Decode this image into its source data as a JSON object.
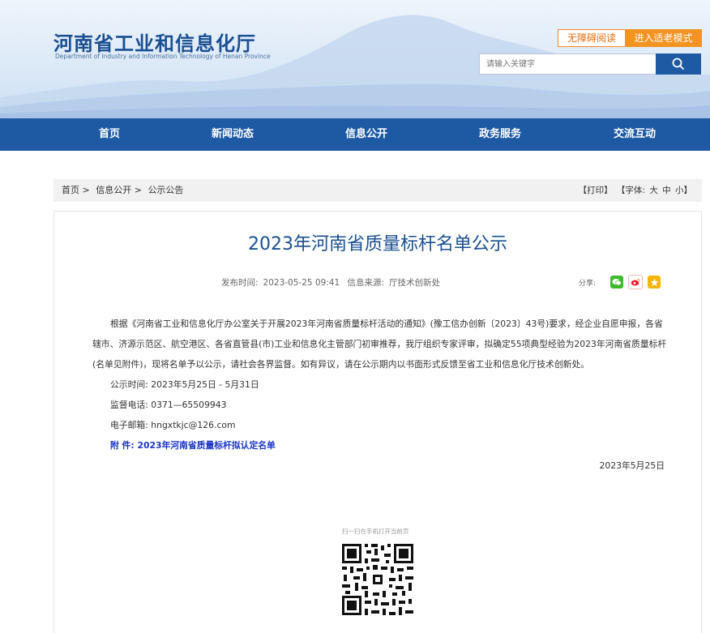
{
  "header": {
    "site_title": "河南省工业和信息化厅",
    "site_subtitle": "Department of Industry and Information Technology of Henan Province",
    "accessibility_label": "无障碍阅读",
    "elder_mode_label": "进入适老模式",
    "search_placeholder": "请输入关键字",
    "brand_color": "#1d5aa3",
    "accent_color": "#f39321"
  },
  "nav": {
    "items": [
      "首页",
      "新闻动态",
      "信息公开",
      "政务服务",
      "交流互动"
    ]
  },
  "breadcrumb": {
    "items": [
      "首页 >",
      "信息公开 >",
      "公示公告"
    ]
  },
  "tools": {
    "print": "【打印】",
    "font_label": "【字体:",
    "font_large": "大",
    "font_medium": "中",
    "font_small": "小】"
  },
  "article": {
    "title": "2023年河南省质量标杆名单公示",
    "publish_label": "发布时间:",
    "publish_time": "2023-05-25 09:41",
    "source_label": "信息来源:",
    "source": "厅技术创新处",
    "share_label": "分享:",
    "share_icons": [
      "wechat-icon",
      "weibo-icon",
      "favorite-icon"
    ],
    "paragraph": "根据《河南省工业和信息化厅办公室关于开展2023年河南省质量标杆活动的通知》(豫工信办创新〔2023〕43号)要求，经企业自愿申报，各省辖市、济源示范区、航空港区、各省直管县(市)工业和信息化主管部门初审推荐，我厅组织专家评审，拟确定55项典型经验为2023年河南省质量标杆(名单见附件)，现将名单予以公示，请社会各界监督。如有异议，请在公示期内以书面形式反馈至省工业和信息化厅技术创新处。",
    "period_label": "公示时间:",
    "period": "2023年5月25日 - 5月31日",
    "phone_label": "监督电话:",
    "phone": "0371—65509943",
    "email_label": "电子邮箱:",
    "email": "hngxtkjc@126.com",
    "attachment_label": "附  件:",
    "attachment": "2023年河南省质量标杆拟认定名单",
    "date": "2023年5月25日",
    "qr_caption": "扫一扫在手机打开当前页"
  }
}
